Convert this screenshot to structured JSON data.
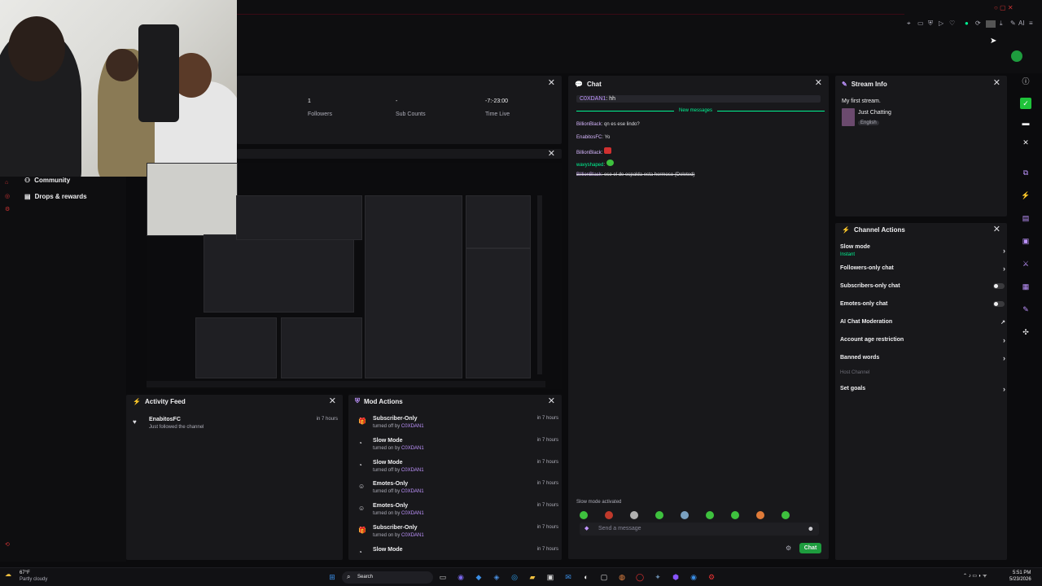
{
  "top_bar": {
    "icons": [
      "bookmark-icon",
      "screen-icon",
      "shield-icon",
      "play-icon",
      "heart-icon",
      "status-icon",
      "refresh-icon",
      "scene-icon",
      "download-icon",
      "edit-icon",
      "ai-icon",
      "menu-icon"
    ],
    "ai_label": "AI"
  },
  "sidebar": {
    "items": [
      {
        "label": "Community",
        "icon": "community-icon"
      },
      {
        "label": "Drops & rewards",
        "icon": "drops-icon"
      }
    ]
  },
  "stats": {
    "followers_value": "1",
    "followers_label": "Followers",
    "subs_value": "-",
    "subs_label": "Sub Counts",
    "time_value": "-7:-23:00",
    "time_label": "Time Live"
  },
  "chat": {
    "title": "Chat",
    "pinned_user": "C0XDAN1",
    "pinned_msg": "hh",
    "new_messages": "New messages",
    "messages": [
      {
        "user": "BillionBlack",
        "text": "qn es ese lindo?"
      },
      {
        "user": "EnabitosFC",
        "text": "Yo"
      },
      {
        "user": "BillionBlack",
        "text": ""
      },
      {
        "user": "wavyshaped",
        "text": ""
      },
      {
        "user": "BillionBlack",
        "text": "ese el de espalda esta hermoso (Deleted)"
      }
    ],
    "slow_mode_notice": "Slow mode activated",
    "input_placeholder": "Send a message",
    "send_label": "Chat"
  },
  "stream_info": {
    "title": "Stream Info",
    "stream_title": "My first stream.",
    "category": "Just Chatting",
    "language": "English"
  },
  "channel_actions": {
    "title": "Channel Actions",
    "items": [
      {
        "label": "Slow mode",
        "sub": "Instant",
        "control": "arrow"
      },
      {
        "label": "Followers-only chat",
        "sub": "",
        "control": "arrow"
      },
      {
        "label": "Subscribers-only chat",
        "sub": "",
        "control": "toggle"
      },
      {
        "label": "Emotes-only chat",
        "sub": "",
        "control": "toggle"
      },
      {
        "label": "AI Chat Moderation",
        "sub": "",
        "control": "link"
      },
      {
        "label": "Account age restriction",
        "sub": "",
        "control": "arrow"
      },
      {
        "label": "Banned words",
        "sub": "",
        "control": "arrow"
      },
      {
        "label": "Host Channel",
        "sub": "",
        "control": "none"
      },
      {
        "label": "Set goals",
        "sub": "",
        "control": "arrow"
      }
    ]
  },
  "activity_feed": {
    "title": "Activity Feed",
    "items": [
      {
        "user": "EnabitosFC",
        "text": "Just followed the channel",
        "time": "in 7 hours"
      }
    ]
  },
  "mod_actions": {
    "title": "Mod Actions",
    "items": [
      {
        "title": "Subscriber-Only",
        "sub": "turned off by",
        "by": "C0XDAN1",
        "time": "in 7 hours",
        "icon": "gift-icon"
      },
      {
        "title": "Slow Mode",
        "sub": "turned on by",
        "by": "C0XDAN1",
        "time": "in 7 hours",
        "icon": "slow-icon"
      },
      {
        "title": "Slow Mode",
        "sub": "turned off by",
        "by": "C0XDAN1",
        "time": "in 7 hours",
        "icon": "slow-icon"
      },
      {
        "title": "Emotes-Only",
        "sub": "turned off by",
        "by": "C0XDAN1",
        "time": "in 7 hours",
        "icon": "emote-icon"
      },
      {
        "title": "Emotes-Only",
        "sub": "turned on by",
        "by": "C0XDAN1",
        "time": "in 7 hours",
        "icon": "emote-icon"
      },
      {
        "title": "Subscriber-Only",
        "sub": "turned on by",
        "by": "C0XDAN1",
        "time": "in 7 hours",
        "icon": "gift-icon"
      },
      {
        "title": "Slow Mode",
        "sub": "",
        "by": "",
        "time": "in 7 hours",
        "icon": "slow-icon"
      }
    ]
  },
  "taskbar": {
    "weather_temp": "67°F",
    "weather_desc": "Partly cloudy",
    "search_label": "Search",
    "time": "5:51 PM",
    "date": "5/23/2026"
  },
  "colors": {
    "accent": "#bf94ff",
    "green": "#00f593",
    "panel": "#18181b",
    "background": "#0b0b0d"
  }
}
